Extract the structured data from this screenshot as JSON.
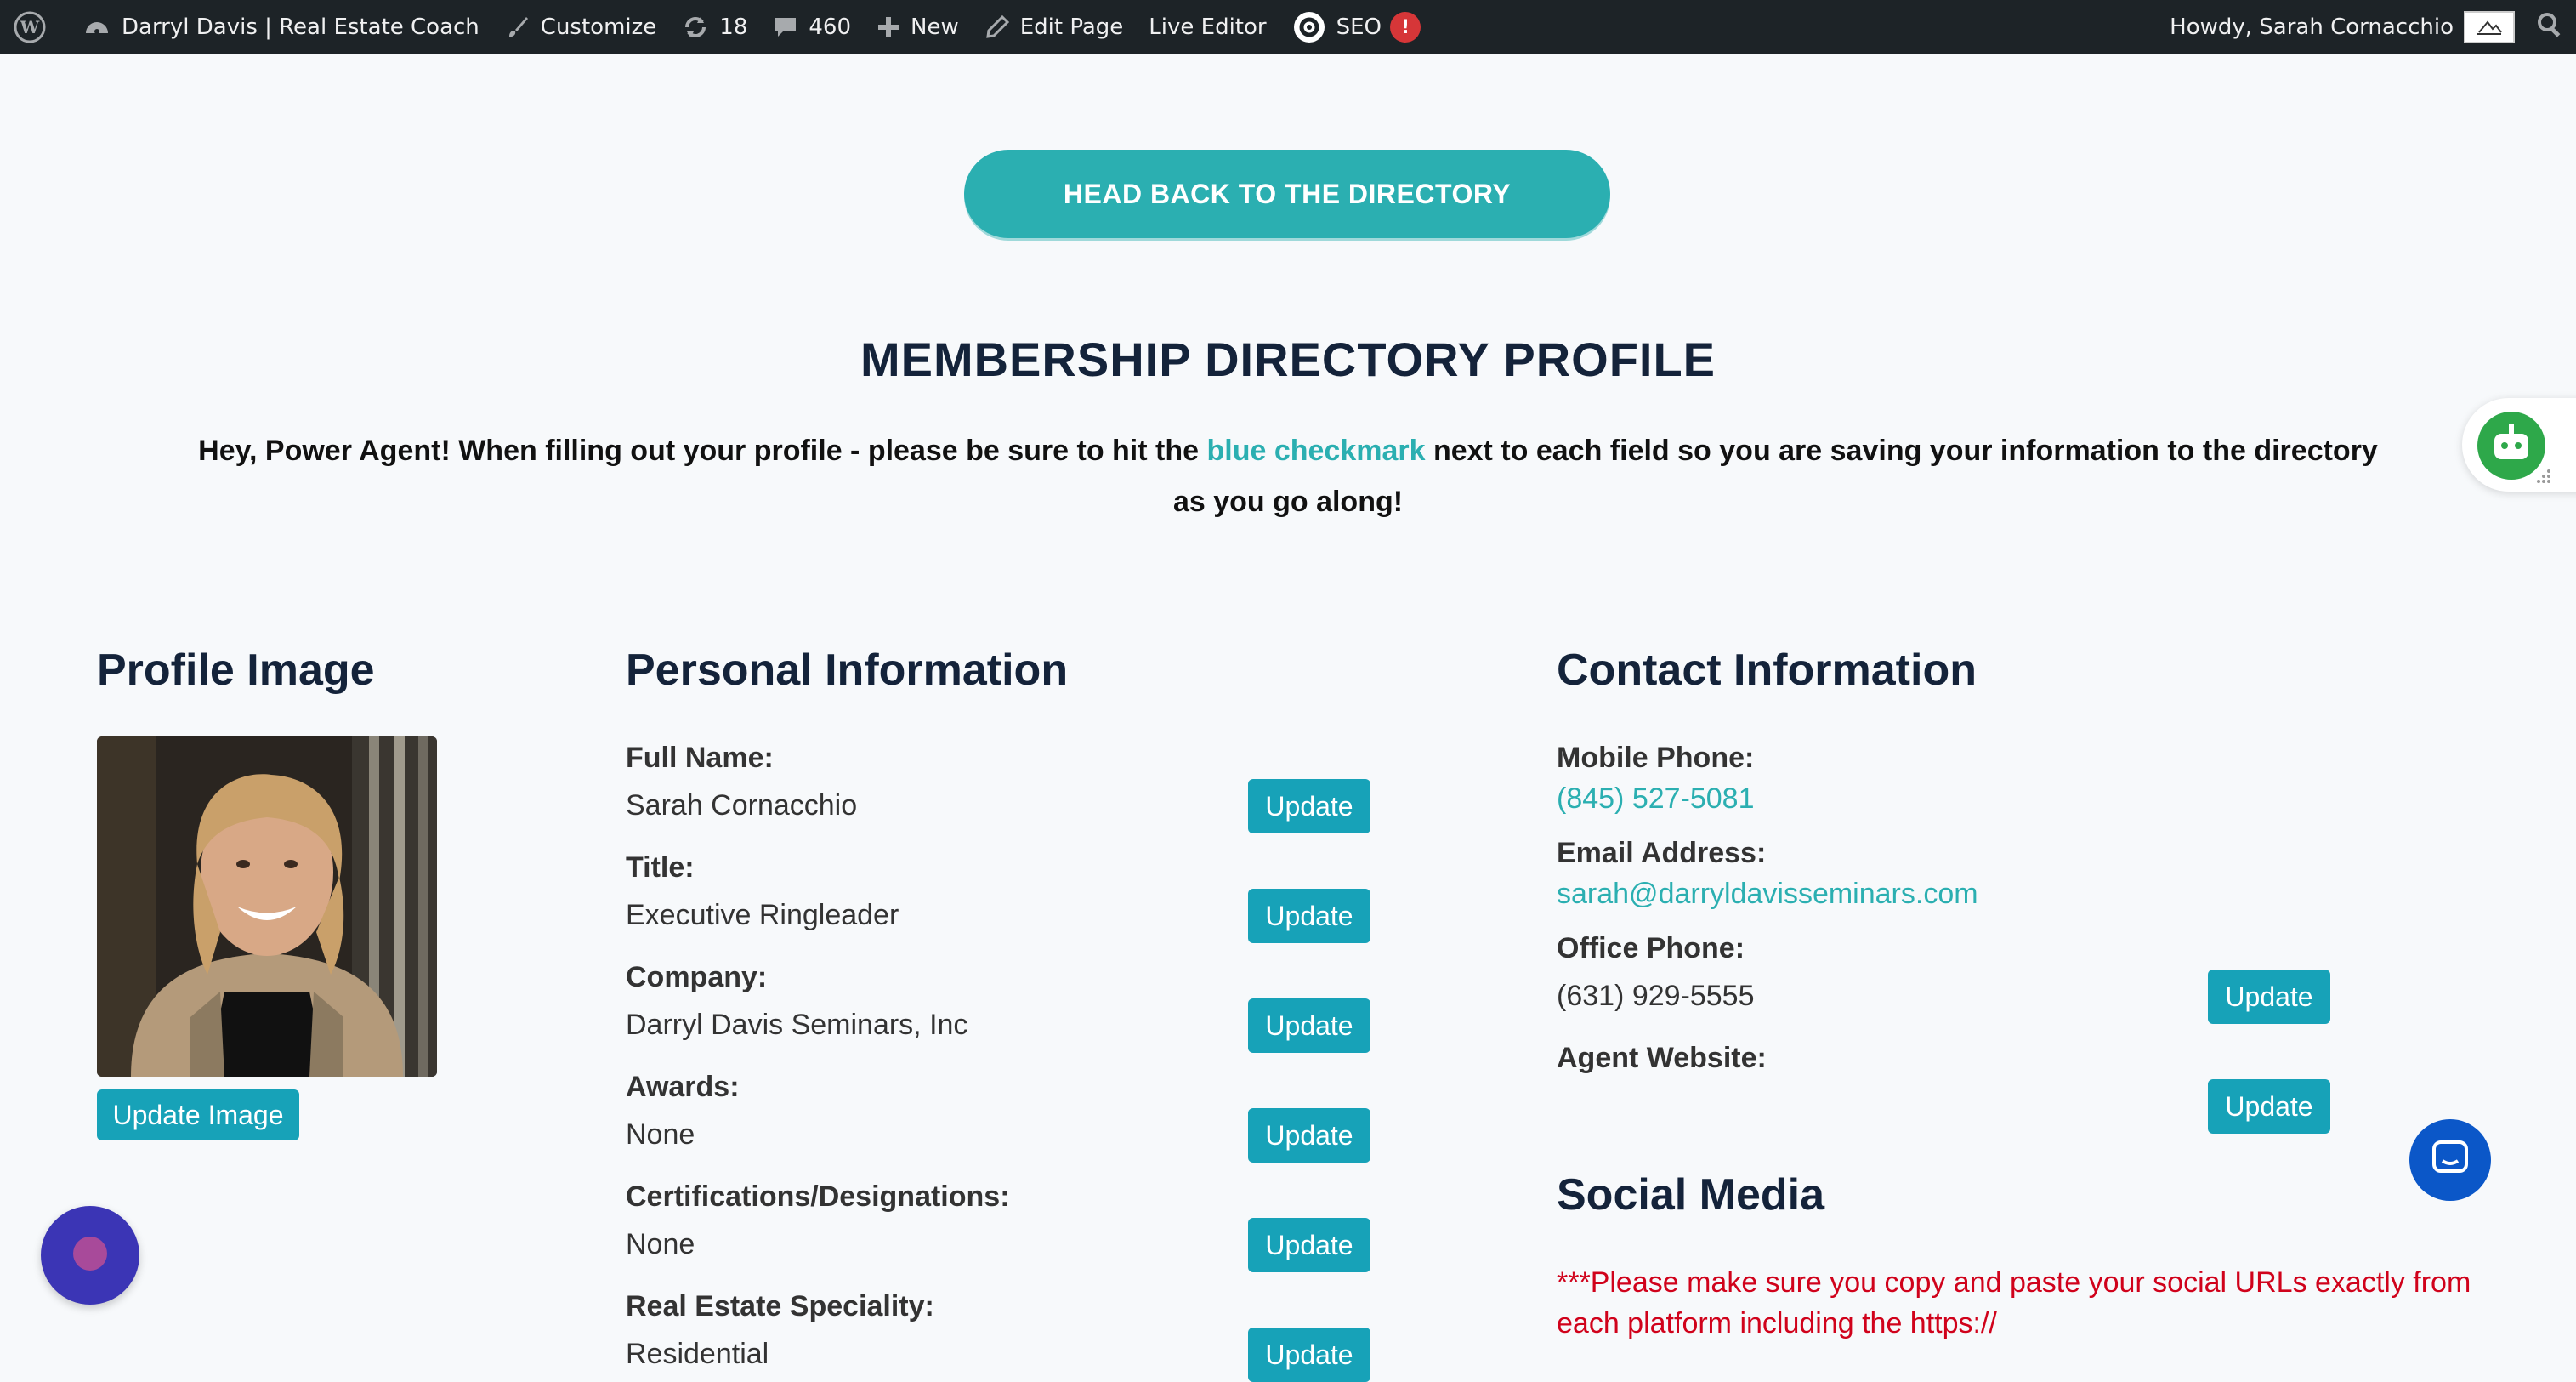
{
  "adminbar": {
    "site_name": "Darryl Davis | Real Estate Coach",
    "customize": "Customize",
    "updates_count": "18",
    "comments_count": "460",
    "new": "New",
    "edit_page": "Edit Page",
    "live_editor": "Live Editor",
    "seo": "SEO",
    "seo_alert": "!",
    "howdy": "Howdy, Sarah Cornacchio"
  },
  "back_button": "HEAD BACK TO THE DIRECTORY",
  "page_title": "MEMBERSHIP DIRECTORY PROFILE",
  "intro": {
    "before": "Hey, Power Agent! When filling out your profile - please be sure to hit the ",
    "highlight": "blue checkmark",
    "after": " next to each field so you are saving your information to the directory as you go along!"
  },
  "profile_image": {
    "heading": "Profile Image",
    "button": "Update Image"
  },
  "personal": {
    "heading": "Personal Information",
    "update_label": "Update",
    "fields": [
      {
        "label": "Full Name:",
        "value": "Sarah Cornacchio"
      },
      {
        "label": "Title:",
        "value": "Executive Ringleader"
      },
      {
        "label": "Company:",
        "value": "Darryl Davis Seminars, Inc"
      },
      {
        "label": "Awards:",
        "value": "None"
      },
      {
        "label": "Certifications/Designations:",
        "value": "None"
      },
      {
        "label": "Real Estate Speciality:",
        "value": "Residential"
      }
    ]
  },
  "contact": {
    "heading": "Contact Information",
    "update_label": "Update",
    "mobile_label": "Mobile Phone:",
    "mobile_value": "(845) 527-5081",
    "email_label": "Email Address:",
    "email_value": "sarah@darryldavisseminars.com",
    "office_label": "Office Phone:",
    "office_value": "(631) 929-5555",
    "website_label": "Agent Website:"
  },
  "social": {
    "heading": "Social Media",
    "warning": "***Please make sure you copy and paste your social URLs exactly from each platform including the https://"
  },
  "colors": {
    "accent": "#2bafb1",
    "button": "#17a2b8",
    "warning": "#d0021b",
    "adminbar": "#1d2327"
  }
}
